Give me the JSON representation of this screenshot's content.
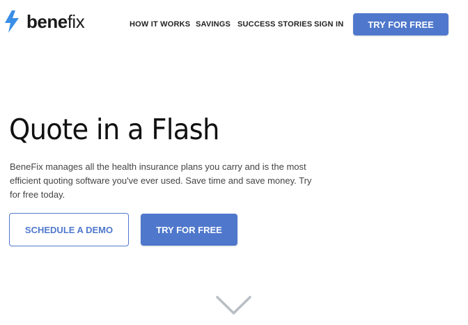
{
  "brand": {
    "name_bold": "bene",
    "name_light": "fix",
    "bolt_color": "#3a8ee6"
  },
  "nav": {
    "items": [
      {
        "label": "HOW IT WORKS"
      },
      {
        "label": "SAVINGS"
      },
      {
        "label": "SUCCESS STORIES"
      },
      {
        "label": "SIGN IN"
      }
    ],
    "cta_label": "TRY FOR FREE"
  },
  "hero": {
    "title": "Quote in a Flash",
    "description": "BeneFix manages all the health insurance plans you carry and is the most efficient quoting software you've ever used. Save time and save money. Try for free today.",
    "secondary_button": "SCHEDULE A DEMO",
    "primary_button": "TRY FOR FREE"
  },
  "colors": {
    "accent": "#4f78cc",
    "text": "#222222"
  },
  "icons": {
    "logo": "lightning-bolt-icon",
    "scroll": "chevron-down-icon"
  }
}
